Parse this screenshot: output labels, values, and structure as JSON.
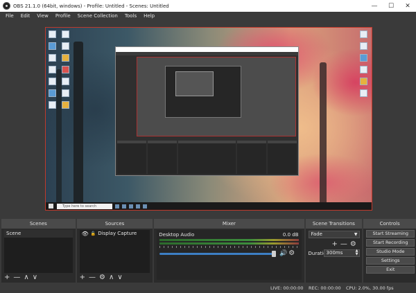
{
  "window": {
    "title": "OBS 21.1.0 (64bit, windows) - Profile: Untitled - Scenes: Untitled",
    "minimize": "—",
    "maximize": "☐",
    "close": "✕"
  },
  "menu": [
    "File",
    "Edit",
    "View",
    "Profile",
    "Scene Collection",
    "Tools",
    "Help"
  ],
  "preview": {
    "taskbar_search": "Type here to search"
  },
  "scenes": {
    "header": "Scenes",
    "items": [
      "Scene"
    ],
    "tools": {
      "add": "+",
      "remove": "—",
      "up": "∧",
      "down": "∨"
    }
  },
  "sources": {
    "header": "Sources",
    "items": [
      {
        "name": "Display Capture",
        "visible_icon": "eye-icon"
      }
    ],
    "tools": {
      "add": "+",
      "remove": "—",
      "settings": "⚙",
      "up": "∧",
      "down": "∨"
    }
  },
  "mixer": {
    "header": "Mixer",
    "channels": [
      {
        "name": "Desktop Audio",
        "db": "0.0 dB",
        "volume": 0.95
      }
    ]
  },
  "transitions": {
    "header": "Scene Transitions",
    "selected": "Fade",
    "duration_label": "Duration",
    "duration_value": "300ms",
    "tools": {
      "add": "+",
      "remove": "—",
      "settings": "⚙"
    }
  },
  "controls": {
    "header": "Controls",
    "buttons": [
      "Start Streaming",
      "Start Recording",
      "Studio Mode",
      "Settings",
      "Exit"
    ]
  },
  "status": {
    "live": "LIVE: 00:00:00",
    "rec": "REC: 00:00:00",
    "cpu": "CPU: 2.0%, 30.00 fps"
  },
  "colors": {
    "accent_border": "#c0392b",
    "dock_bg": "#2b2b2b",
    "panel_bg": "#3a3a3a"
  }
}
